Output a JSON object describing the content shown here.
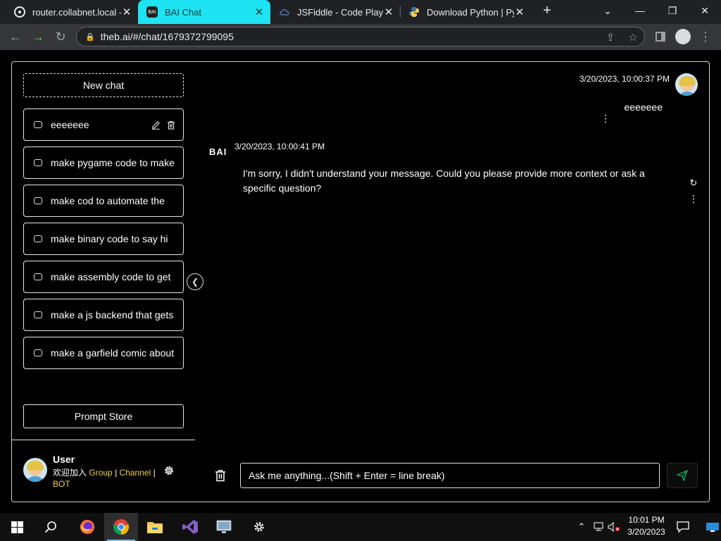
{
  "browser": {
    "tabs": [
      {
        "title": "router.collabnet.local -",
        "active": false
      },
      {
        "title": "BAI Chat",
        "active": true
      },
      {
        "title": "JSFiddle - Code Playgro",
        "active": false
      },
      {
        "title": "Download Python | Pyt",
        "active": false
      }
    ],
    "new_tab_icon": "plus-icon",
    "url": "theb.ai/#/chat/1679372799095",
    "colors": {
      "active_tab": "#1ee3f2",
      "tabbar": "#202124",
      "toolbar": "#35363a"
    }
  },
  "app": {
    "new_chat_label": "New chat",
    "chats": [
      {
        "title": "eeeeeee",
        "editable": true
      },
      {
        "title": "make pygame code to make"
      },
      {
        "title": "make cod to automate the"
      },
      {
        "title": "make binary code to say hi"
      },
      {
        "title": "make assembly code to get"
      },
      {
        "title": "make a js backend that gets"
      },
      {
        "title": "make a garfield comic about"
      }
    ],
    "prompt_store_label": "Prompt Store",
    "user": {
      "name": "User",
      "join_text": "欢迎加入",
      "group_label": "Group",
      "separator": "|",
      "channel_label": "Channel",
      "bot_label": "BOT"
    },
    "messages": {
      "user": {
        "timestamp": "3/20/2023, 10:00:37 PM",
        "text": "eeeeeee"
      },
      "bot": {
        "logo": "BAI",
        "timestamp": "3/20/2023, 10:00:41 PM",
        "text": "I'm sorry, I didn't understand your message. Could you please provide more context or ask a specific question?"
      }
    },
    "input": {
      "placeholder": "Ask me anything...(Shift + Enter = line break)",
      "value": ""
    },
    "link_color": "#f2d13f",
    "send_color": "#18a058"
  },
  "taskbar": {
    "clock_time": "10:01 PM",
    "clock_date": "3/20/2023",
    "apps": [
      "start-icon",
      "search-icon",
      "firefox-icon",
      "chrome-icon",
      "file-explorer-icon",
      "visual-studio-icon",
      "remote-desktop-icon",
      "settings-icon"
    ]
  }
}
